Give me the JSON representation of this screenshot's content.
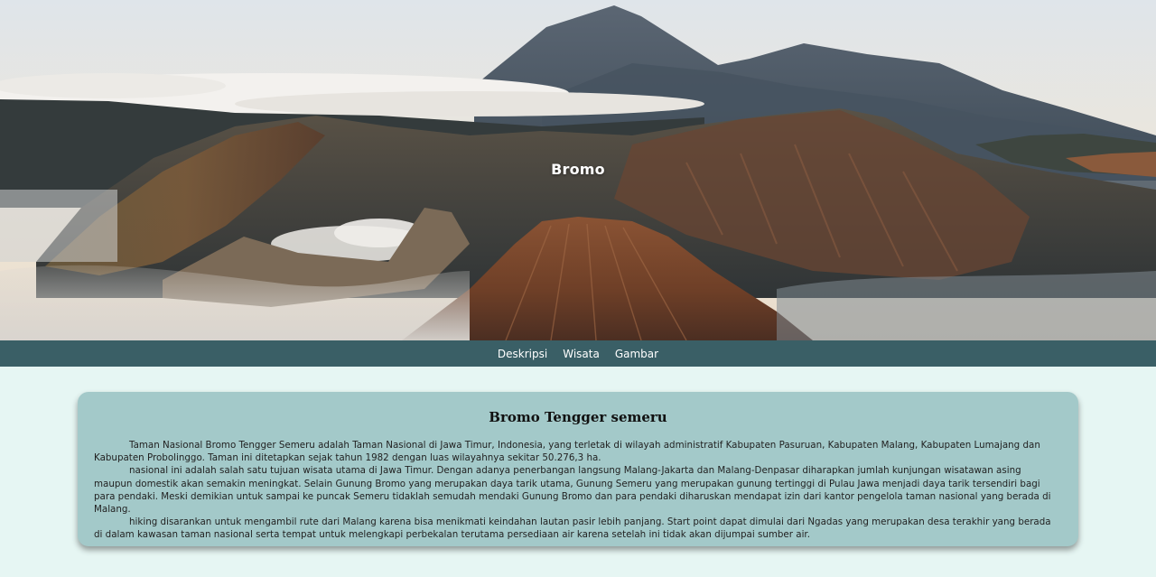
{
  "hero": {
    "title": "Bromo"
  },
  "nav": {
    "items": [
      {
        "label": "Deskripsi"
      },
      {
        "label": "Wisata"
      },
      {
        "label": "Gambar"
      }
    ]
  },
  "card": {
    "heading": "Bromo Tengger semeru",
    "paragraphs": [
      "Taman Nasional Bromo Tengger Semeru adalah Taman Nasional di Jawa Timur, Indonesia, yang terletak di wilayah administratif Kabupaten Pasuruan, Kabupaten Malang, Kabupaten Lumajang dan Kabupaten Probolinggo. Taman ini ditetapkan sejak tahun 1982 dengan luas wilayahnya sekitar 50.276,3 ha.",
      "nasional ini adalah salah satu tujuan wisata utama di Jawa Timur. Dengan adanya penerbangan langsung Malang-Jakarta dan Malang-Denpasar diharapkan jumlah kunjungan wisatawan asing maupun domestik akan semakin meningkat. Selain Gunung Bromo yang merupakan daya tarik utama, Gunung Semeru yang merupakan gunung tertinggi di Pulau Jawa menjadi daya tarik tersendiri bagi para pendaki. Meski demikian untuk sampai ke puncak Semeru tidaklah semudah mendaki Gunung Bromo dan para pendaki diharuskan mendapat izin dari kantor pengelola taman nasional yang berada di Malang.",
      "hiking disarankan untuk mengambil rute dari Malang karena bisa menikmati keindahan lautan pasir lebih panjang. Start point dapat dimulai dari Ngadas yang merupakan desa terakhir yang berada di dalam kawasan taman nasional serta tempat untuk melengkapi perbekalan terutama persediaan air karena setelah ini tidak akan dijumpai sumber air."
    ]
  },
  "colors": {
    "page_bg": "#e6f6f3",
    "nav_bg": "#3a5f66",
    "card_bg": "#a3c9c9"
  }
}
